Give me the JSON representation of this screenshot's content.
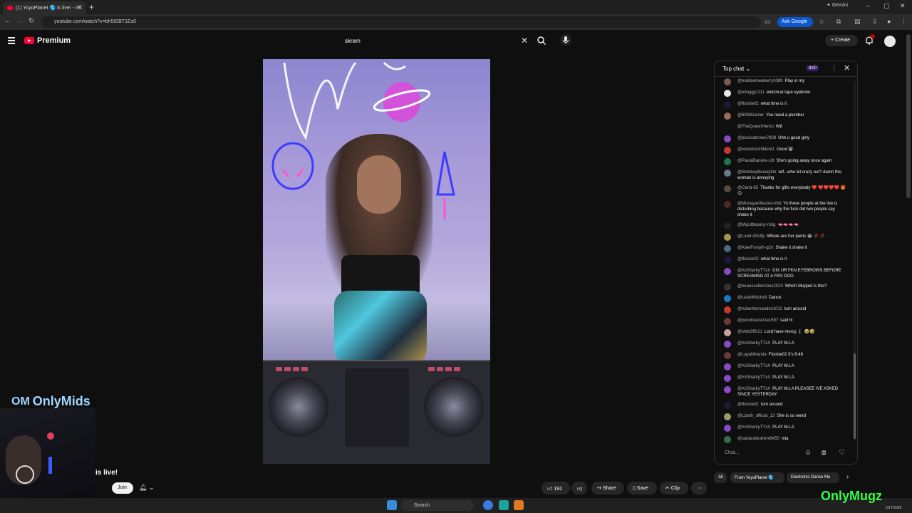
{
  "browser": {
    "tab_title": "(1) YoyoPlanet 🌎 is live! - Yo",
    "url": "youtube.com/watch?v=bh5tSBT1Es0",
    "ask_google": "Ask Google",
    "gemini": "Gemini"
  },
  "header": {
    "brand": "Premium",
    "search_value": "skram",
    "create_label": "Create",
    "notifications_count": "1"
  },
  "overlay": {
    "onlymids": "OnlyMids",
    "onlymugz": "OnlyMugz"
  },
  "channel": {
    "live_text": "is live!",
    "join_label": "Join"
  },
  "actions": {
    "likes": "191",
    "share": "Share",
    "save": "Save",
    "clip": "Clip"
  },
  "chat": {
    "title": "Top chat",
    "badge": "8XP",
    "placeholder": "Chat...",
    "messages": [
      {
        "author": "@mallowmeaberry3089",
        "text": "Play in my",
        "color": "#7a5a4a"
      },
      {
        "author": "@edoggy1111",
        "text": "electrical tape eyebrow",
        "color": "#e8e8e8"
      },
      {
        "author": "@flockie02",
        "text": "what time is it",
        "color": "#1a1a3a"
      },
      {
        "author": "@60fifiGamer",
        "text": "You need a plumber",
        "color": "#9a6a5a"
      },
      {
        "author": "@TheQueenHeron",
        "text": "Wtf",
        "color": "#111111"
      },
      {
        "author": "@jessicabrown7808",
        "text": "Uhh u good girly",
        "color": "#8a4ac8"
      },
      {
        "author": "@remainconfident1",
        "text": "Good 😸",
        "color": "#c83a2a"
      },
      {
        "author": "@PaulaDaniels-s3t",
        "text": "She's going away once again",
        "color": "#1a7a4a"
      },
      {
        "author": "@BombayBeautyOk",
        "text": "wtf...who let crazy out? damn this woman is annoying",
        "color": "#6a7a8a"
      },
      {
        "author": "@Carla-65",
        "text": "Thanks for gifts everybody ❤️ ❤️❤️❤️❤️ 🎁😊",
        "color": "#5a4a3a"
      },
      {
        "author": "@MunayaAlharasi-n6d",
        "text": "Yo these people at the live is disturbing because why the fuck did two people say shake it",
        "color": "#4a2a2a"
      },
      {
        "author": "@MyLittlepony-m3g",
        "text": "🫦🫦🫦🫦",
        "color": "#222222"
      },
      {
        "author": "@Land-dSc9p",
        "text": "Where are her pants 😭 🥀 🥀",
        "color": "#a09a4a"
      },
      {
        "author": "@KateForsyth-g2n",
        "text": "Shake it shake it",
        "color": "#4a6a8a"
      },
      {
        "author": "@flockie02",
        "text": "what time is it",
        "color": "#1a1a3a"
      },
      {
        "author": "@XxSharkyTTxX",
        "text": "DIX UR FKN EYEBROWS BEFORE SCREAMING AT A FKN DOG",
        "color": "#8a4ac8"
      },
      {
        "author": "@beanscollections2020",
        "text": "Which Muppet is this?",
        "color": "#333333"
      },
      {
        "author": "@LeiahMitchell",
        "text": "Dance",
        "color": "#1a7ac8"
      },
      {
        "author": "@rubenhernandez1011",
        "text": "turn around",
        "color": "#c83a2a"
      },
      {
        "author": "@yonolcarranza1597",
        "text": "said hi",
        "color": "#6a3a3a"
      },
      {
        "author": "@Vaht3f5r21",
        "text": "Lord have mercy 🧎‍♀️ 🤣🤣",
        "color": "#caa0a0"
      },
      {
        "author": "@XxSharkyTTxX",
        "text": "PLAY M.I.A",
        "color": "#8a4ac8"
      },
      {
        "author": "@LayaMiranda",
        "text": "Flockie02 It's 8:48",
        "color": "#6a3a3a"
      },
      {
        "author": "@XxSharkyTTxX",
        "text": "PLAY M.I.A",
        "color": "#8a4ac8"
      },
      {
        "author": "@XxSharkyTTxX",
        "text": "PLAY M.I.A",
        "color": "#8a4ac8"
      },
      {
        "author": "@XxSharkyTTxX",
        "text": "PLAY M.I.A PLEASEE IVE ASKED SINCE YESTERDAY",
        "color": "#8a4ac8"
      },
      {
        "author": "@flockie02",
        "text": "turn around",
        "color": "#1a1a3a"
      },
      {
        "author": "@Lizeth_official_13",
        "text": "She is so weird",
        "color": "#9a9a6a"
      },
      {
        "author": "@XxSharkyTTxX",
        "text": "PLAY M.I.A",
        "color": "#8a4ac8"
      },
      {
        "author": "@sabaraibrahimi6455",
        "text": "mia",
        "color": "#3a6a4a"
      }
    ]
  },
  "chips": {
    "all": "All",
    "from": "From YoyoPlanet 🌎",
    "edm": "Electronic Dance Mu"
  },
  "taskbar": {
    "search": "Search",
    "date": "2/17/2026"
  }
}
